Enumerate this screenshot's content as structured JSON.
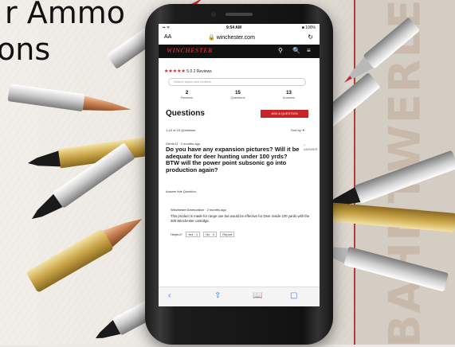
{
  "headline": {
    "line1": "r Ammo",
    "line2": "ons"
  },
  "vertical_text": "BAHNTWERLE",
  "phone": {
    "status": {
      "left": "▪︎▪︎ ᯤ",
      "time": "9:54 AM",
      "battery": "■ 100%"
    },
    "address": {
      "aa": "AA",
      "url": "🔒 winchester.com",
      "reload": "↻"
    },
    "nav": {
      "logo": "WINCHESTER",
      "pin": "⚲",
      "search": "🔍",
      "menu": "≡"
    },
    "rating": {
      "stars": "★★★★★",
      "score": "5.0",
      "reviews": "2 Reviews"
    },
    "search_placeholder": "Search topics and reviews",
    "stats": [
      {
        "n": "2",
        "label": "Reviews"
      },
      {
        "n": "15",
        "label": "Questions"
      },
      {
        "n": "13",
        "label": "Answers"
      }
    ],
    "questions_title": "Questions",
    "ask_button": "ASK A QUESTION",
    "count": "1-10 of 15 Questions",
    "sort": "Sort by: ▾",
    "asker": "Gerrie11 · 2 months ago",
    "question": "Do you have any expansion pictures? Will it be adequate for deer hunting under 100 yrds? BTW will the power point subsonic go into production again?",
    "vote": "^ ANSWER",
    "answer_link": "Answer this Question",
    "answerer": "Winchester Ammunition · 2 months ago",
    "answer": "This product is made for range use but would be effective for Deer inside 100 yards with the 300 Winchester cartridge.",
    "helpful": {
      "label": "Helpful?",
      "yes": "Yes · 1",
      "no": "No · 0",
      "report": "Report"
    },
    "bottom": {
      "back": "‹",
      "share": "⇧",
      "book": "📖",
      "tabs": "▢"
    }
  }
}
